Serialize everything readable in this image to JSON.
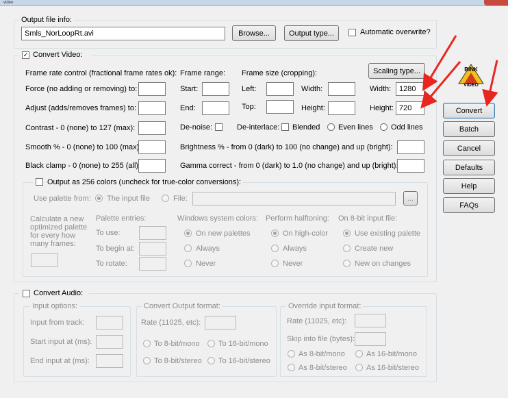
{
  "title_small": "video",
  "output": {
    "legend": "Output file info:",
    "filename": "Smls_NorLoopRt.avi",
    "browse": "Browse...",
    "output_type": "Output type...",
    "overwrite": "Automatic overwrite?"
  },
  "video": {
    "legend": "Convert Video:",
    "frame_rate_control": "Frame rate control (fractional frame rates ok):",
    "force": "Force (no adding or removing) to:",
    "adjust": "Adjust (adds/removes frames) to:",
    "frame_range": "Frame range:",
    "start": "Start:",
    "end": "End:",
    "frame_size": "Frame size (cropping):",
    "left": "Left:",
    "top": "Top:",
    "width_crop": "Width:",
    "height_crop": "Height:",
    "scaling_type": "Scaling type...",
    "width_label": "Width:",
    "height_label": "Height:",
    "width_value": "1280",
    "height_value": "720",
    "contrast": "Contrast - 0 (none) to 127 (max):",
    "smooth": "Smooth % - 0 (none) to 100 (max):",
    "black_clamp": "Black clamp - 0 (none) to 255 (all):",
    "denoise": "De-noise:",
    "deinterlace": "De-interlace:",
    "blended": "Blended",
    "even_lines": "Even lines",
    "odd_lines": "Odd lines",
    "brightness": "Brightness % - from 0 (dark) to 100 (no change) and up (bright):",
    "gamma": "Gamma correct - from 0 (dark) to 1.0 (no change) and up (bright):"
  },
  "colors256": {
    "legend": "Output as 256 colors (uncheck for true-color conversions):",
    "use_palette_from": "Use palette from:",
    "input_file": "The input file",
    "file": "File:",
    "file_browse": "...",
    "calculate": "Calculate a new optimized palette for every how many frames:",
    "palette_entries": "Palette entries:",
    "to_use": "To use:",
    "to_begin_at": "To begin at:",
    "to_rotate": "To rotate:",
    "windows_colors": "Windows system colors:",
    "on_new_palettes": "On new palettes",
    "always": "Always",
    "never": "Never",
    "halftoning": "Perform halftoning:",
    "on_high_color": "On high-color",
    "always2": "Always",
    "never2": "Never",
    "on8bit": "On 8-bit input file:",
    "use_existing": "Use existing palette",
    "create_new": "Create new",
    "new_on_changes": "New on changes"
  },
  "audio": {
    "legend": "Convert Audio:",
    "input_options": "Input options:",
    "input_from_track": "Input from track:",
    "start_input": "Start input at (ms):",
    "end_input": "End input at (ms):",
    "convert_output": "Convert Output format:",
    "rate": "Rate (11025, etc):",
    "to8mono": "To 8-bit/mono",
    "to16mono": "To 16-bit/mono",
    "to8stereo": "To 8-bit/stereo",
    "to16stereo": "To 16-bit/stereo",
    "override": "Override input format:",
    "rate2": "Rate (11025, etc):",
    "skip": "Skip into file (bytes):",
    "as8mono": "As 8-bit/mono",
    "as16mono": "As 16-bit/mono",
    "as8stereo": "As 8-bit/stereo",
    "as16stereo": "As 16-bit/stereo"
  },
  "side_buttons": {
    "convert": "Convert",
    "batch": "Batch",
    "cancel": "Cancel",
    "defaults": "Defaults",
    "help": "Help",
    "faqs": "FAQs"
  },
  "logo": {
    "line1": "BINK",
    "line2": "VIDEO"
  },
  "colors": {
    "arrow": "#e8261f",
    "accent": "#3c7fb1"
  },
  "icons": [
    "check-icon",
    "arrow-annotation-icon",
    "bink-logo-icon"
  ]
}
